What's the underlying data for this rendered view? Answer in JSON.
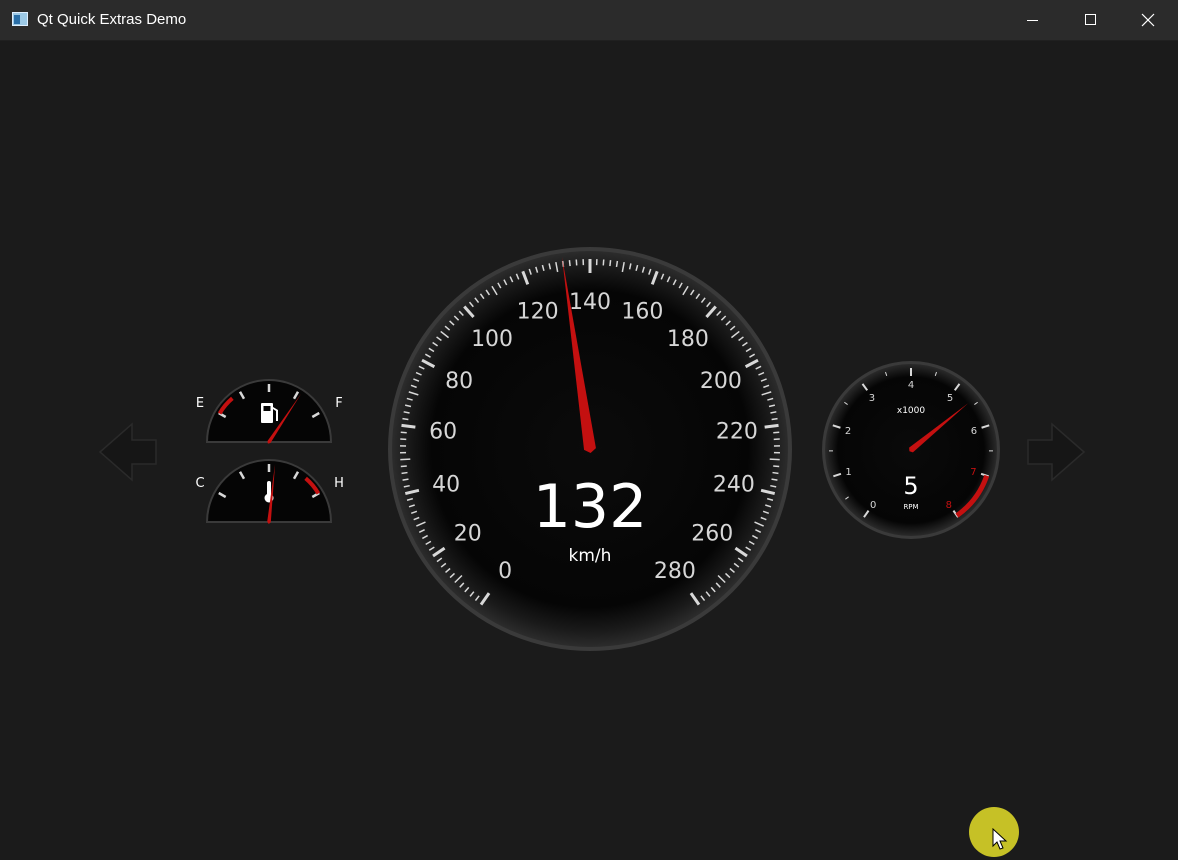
{
  "window": {
    "title": "Qt Quick Extras Demo"
  },
  "colors": {
    "needle": "#c41010",
    "redzone": "#c41010",
    "background": "#1b1b1b",
    "titlebar": "#2b2b2b",
    "cursor_halo": "#e4de28"
  },
  "speedometer": {
    "value": 132,
    "value_label": "132",
    "unit": "km/h",
    "min": 0,
    "max": 280,
    "tick_labels": [
      "0",
      "20",
      "40",
      "60",
      "80",
      "100",
      "120",
      "140",
      "160",
      "180",
      "200",
      "220",
      "240",
      "260",
      "280"
    ]
  },
  "fuel_gauge": {
    "empty_label": "E",
    "full_label": "F",
    "level": 0.78,
    "icon": "fuel-pump-icon"
  },
  "temperature_gauge": {
    "cold_label": "C",
    "hot_label": "H",
    "level": 0.55,
    "icon": "thermometer-icon"
  },
  "tachometer": {
    "value": 5.4,
    "gear_label": "5",
    "unit": "RPM",
    "multiplier": "x1000",
    "min": 0,
    "max": 8,
    "tick_labels": [
      "0",
      "1",
      "2",
      "3",
      "4",
      "5",
      "6",
      "7",
      "8"
    ]
  },
  "turn_signals": {
    "left_icon": "left-arrow-icon",
    "right_icon": "right-arrow-icon"
  }
}
